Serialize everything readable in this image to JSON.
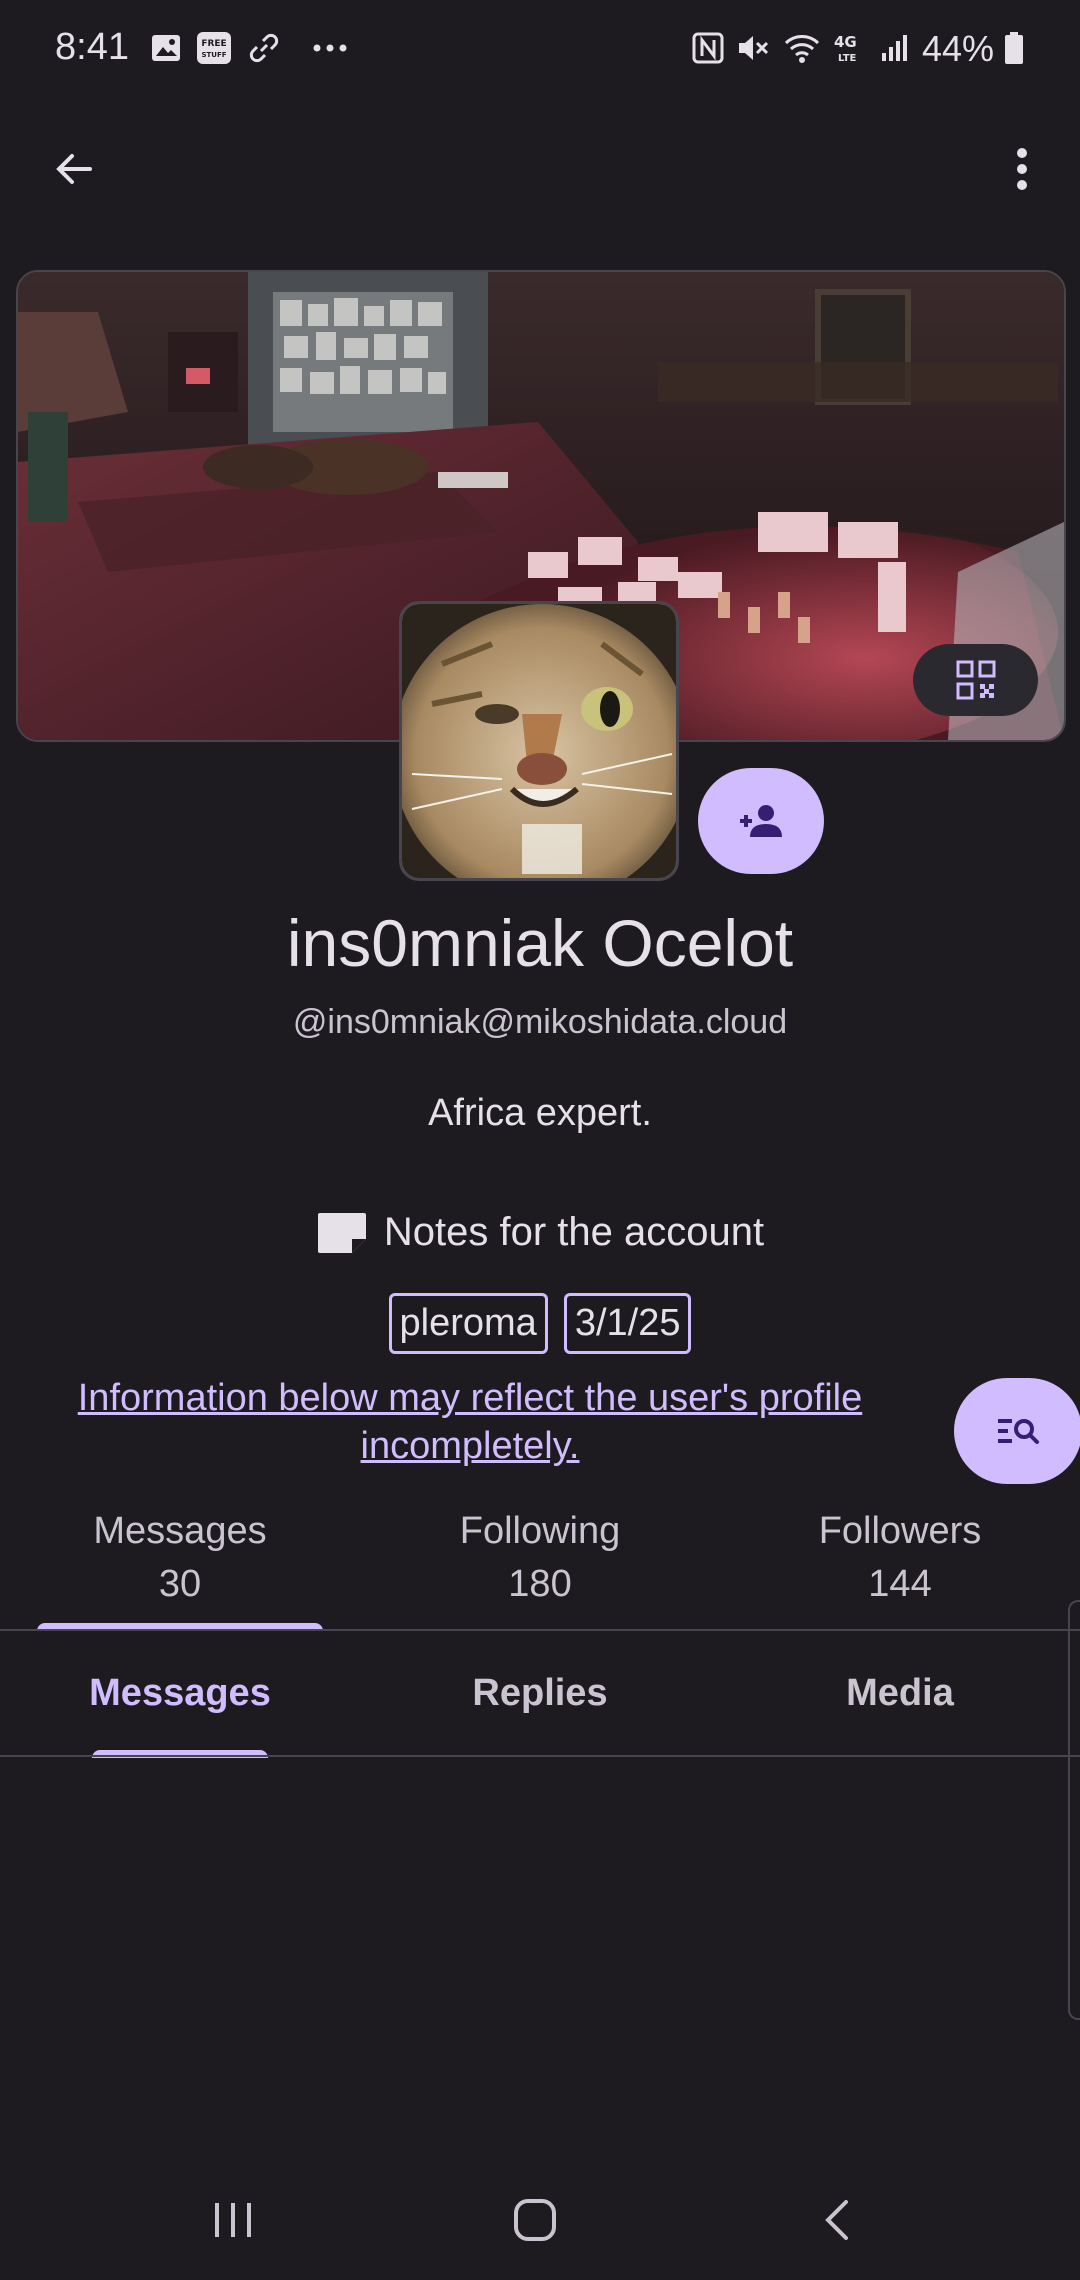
{
  "status_bar": {
    "time": "8:41",
    "battery": "44%",
    "icons": [
      "image-icon",
      "free-stuff-icon",
      "link-icon",
      "more-dots-icon",
      "nfc-icon",
      "mute-icon",
      "wifi-icon",
      "4g-lte-icon",
      "signal-icon",
      "battery-icon"
    ],
    "free_badge": "FREE STUFF",
    "lte_label": "4G LTE"
  },
  "top_bar": {
    "back_icon": "arrow-back-icon",
    "menu_icon": "more-vert-icon"
  },
  "profile": {
    "display_name": "ins0mniak Ocelot",
    "account": "@ins0mniak@mikoshidata.cloud",
    "bio": "Africa expert.",
    "notes_label": "Notes for the account",
    "tags": [
      "pleroma",
      "3/1/25"
    ],
    "info_notice": "Information below may reflect the user's profile incompletely."
  },
  "stats": [
    {
      "label": "Messages",
      "value": "30"
    },
    {
      "label": "Following",
      "value": "180"
    },
    {
      "label": "Followers",
      "value": "144"
    }
  ],
  "tabs": [
    "Messages",
    "Replies",
    "Media"
  ],
  "colors": {
    "background": "#1d1b20",
    "accent": "#d0bcff",
    "on_accent": "#381e72",
    "divider": "#49454f"
  }
}
